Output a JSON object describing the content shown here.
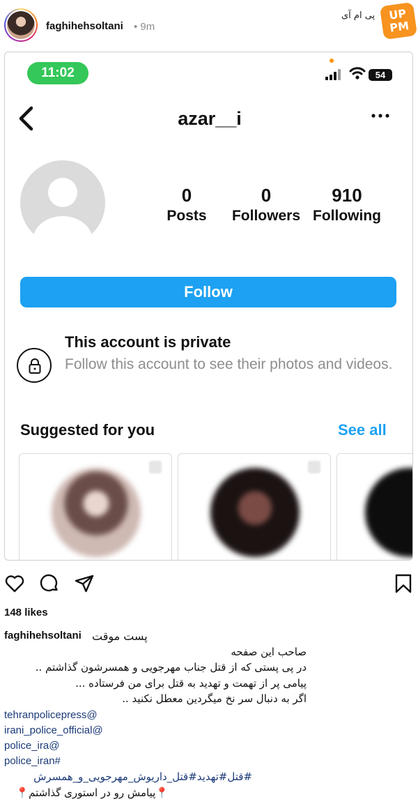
{
  "post": {
    "username": "faghihehsoltani",
    "time": "• 9m",
    "brand_text": "پی ام آی",
    "brand_logo": "UP PM"
  },
  "screenshot": {
    "status_time": "11:02",
    "battery": "54",
    "profile": {
      "username": "azar__i",
      "stats": [
        {
          "value": "0",
          "label": "Posts"
        },
        {
          "value": "0",
          "label": "Followers"
        },
        {
          "value": "910",
          "label": "Following"
        }
      ],
      "follow_label": "Follow",
      "private_title": "This account is private",
      "private_desc": "Follow this account to see their photos and videos."
    },
    "suggested": {
      "title": "Suggested for you",
      "see_all": "See all"
    }
  },
  "actions": {
    "icons": [
      "heart-icon",
      "comment-icon",
      "share-icon",
      "bookmark-icon"
    ]
  },
  "likes": "148 likes",
  "caption": {
    "first_line": "پست موقت",
    "lines": [
      "صاحب این صفحه",
      "در پی پستی که از قتل جناب مهرجویی و همسرشون گذاشتم ..",
      "پیامی پر از تهمت و تهدید به قتل برای من فرستاده ...",
      "اگر به دنبال سر نخ میگردین معطل نکنید .."
    ],
    "mentions": [
      "tehranpolicepress@",
      "irani_police_official@",
      "police_ira@",
      "police_iran#"
    ],
    "hashtags": "#قتل#تهدید#قتل_داریوش_مهرجویی_و_همسرش",
    "last_line": "📍پیامش رو در استوری گذاشتم📍"
  }
}
